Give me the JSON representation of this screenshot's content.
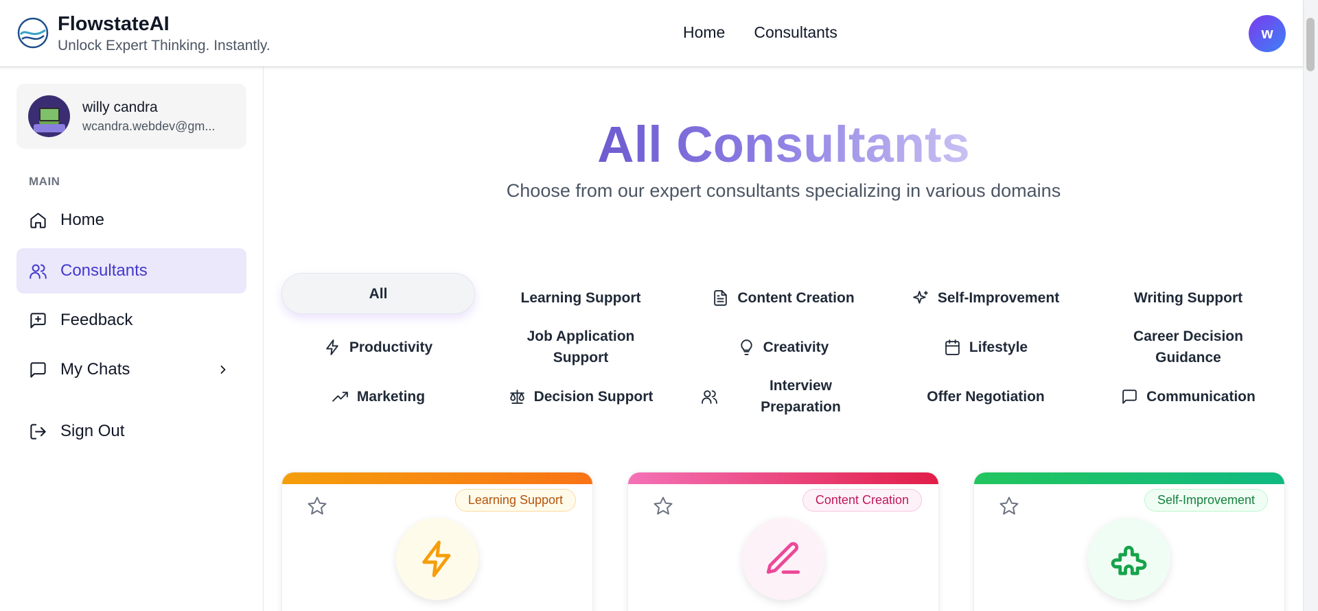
{
  "header": {
    "brand_name": "FlowstateAI",
    "tagline": "Unlock Expert Thinking. Instantly.",
    "nav": [
      {
        "label": "Home"
      },
      {
        "label": "Consultants"
      }
    ],
    "avatar_initial": "w"
  },
  "sidebar": {
    "user": {
      "name": "willy candra",
      "email": "wcandra.webdev@gm..."
    },
    "section_label": "MAIN",
    "items": [
      {
        "label": "Home",
        "icon": "home-icon"
      },
      {
        "label": "Consultants",
        "icon": "users-icon",
        "active": true
      },
      {
        "label": "Feedback",
        "icon": "message-plus-icon"
      },
      {
        "label": "My Chats",
        "icon": "message-square-icon"
      },
      {
        "label": "Sign Out",
        "icon": "log-out-icon"
      }
    ]
  },
  "main": {
    "title": "All Consultants",
    "subtitle": "Choose from our expert consultants specializing in various domains",
    "categories": [
      {
        "label": "All",
        "icon": "",
        "active": true
      },
      {
        "label": "Learning Support",
        "icon": ""
      },
      {
        "label": "Content Creation",
        "icon": "file-text-icon"
      },
      {
        "label": "Self-Improvement",
        "icon": "sparkles-icon"
      },
      {
        "label": "Writing Support",
        "icon": ""
      },
      {
        "label": "Productivity",
        "icon": "zap-icon"
      },
      {
        "label": "Job Application Support",
        "icon": ""
      },
      {
        "label": "Creativity",
        "icon": "lightbulb-icon"
      },
      {
        "label": "Lifestyle",
        "icon": "calendar-icon"
      },
      {
        "label": "Career Decision Guidance",
        "icon": ""
      },
      {
        "label": "Marketing",
        "icon": "trending-up-icon"
      },
      {
        "label": "Decision Support",
        "icon": "scale-icon"
      },
      {
        "label": "Interview Preparation",
        "icon": "users-icon"
      },
      {
        "label": "Offer Negotiation",
        "icon": ""
      },
      {
        "label": "Communication",
        "icon": "message-square-icon"
      }
    ],
    "cards": [
      {
        "badge": "Learning Support",
        "icon": "zap-icon",
        "accent": "#f59e0b",
        "accent2": "#f97316",
        "badge_bg": "#fffbeb",
        "badge_color": "#b45309",
        "badge_border": "#fcd9a0",
        "icon_bg": "#fffbeb"
      },
      {
        "badge": "Content Creation",
        "icon": "pen-icon",
        "accent": "#f472b6",
        "accent2": "#e11d48",
        "badge_bg": "#fdf2f8",
        "badge_color": "#be185d",
        "badge_border": "#f9c4dd",
        "icon_bg": "#fdf2f8"
      },
      {
        "badge": "Self-Improvement",
        "icon": "puzzle-icon",
        "accent": "#22c55e",
        "accent2": "#10b981",
        "badge_bg": "#f0fdf4",
        "badge_color": "#15803d",
        "badge_border": "#bbf7d0",
        "icon_bg": "#f0fdf4"
      }
    ]
  },
  "colors": {
    "accent": "#4338ca",
    "active_bg": "#ebe8fb",
    "title_gradient": [
      "#6d5bd0",
      "#c9c1f3"
    ]
  }
}
